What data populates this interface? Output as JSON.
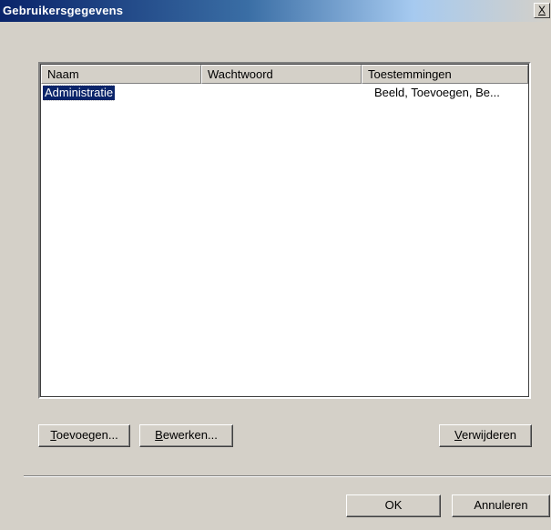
{
  "window": {
    "title": "Gebruikersgegevens",
    "close_label": "X"
  },
  "listview": {
    "columns": [
      {
        "label": "Naam"
      },
      {
        "label": "Wachtwoord"
      },
      {
        "label": "Toestemmingen"
      }
    ],
    "rows": [
      {
        "name": "Administratie",
        "password": "",
        "permissions": "Beeld, Toevoegen, Be...",
        "selected": true
      }
    ]
  },
  "buttons": {
    "add": {
      "mnemonic": "T",
      "rest": "oevoegen..."
    },
    "edit": {
      "mnemonic": "B",
      "rest": "ewerken..."
    },
    "delete": {
      "mnemonic": "V",
      "rest": "erwijderen"
    },
    "ok": "OK",
    "cancel": "Annuleren"
  },
  "colors": {
    "face": "#d4d0c8",
    "title_start": "#0a246a",
    "selection": "#0a246a"
  }
}
